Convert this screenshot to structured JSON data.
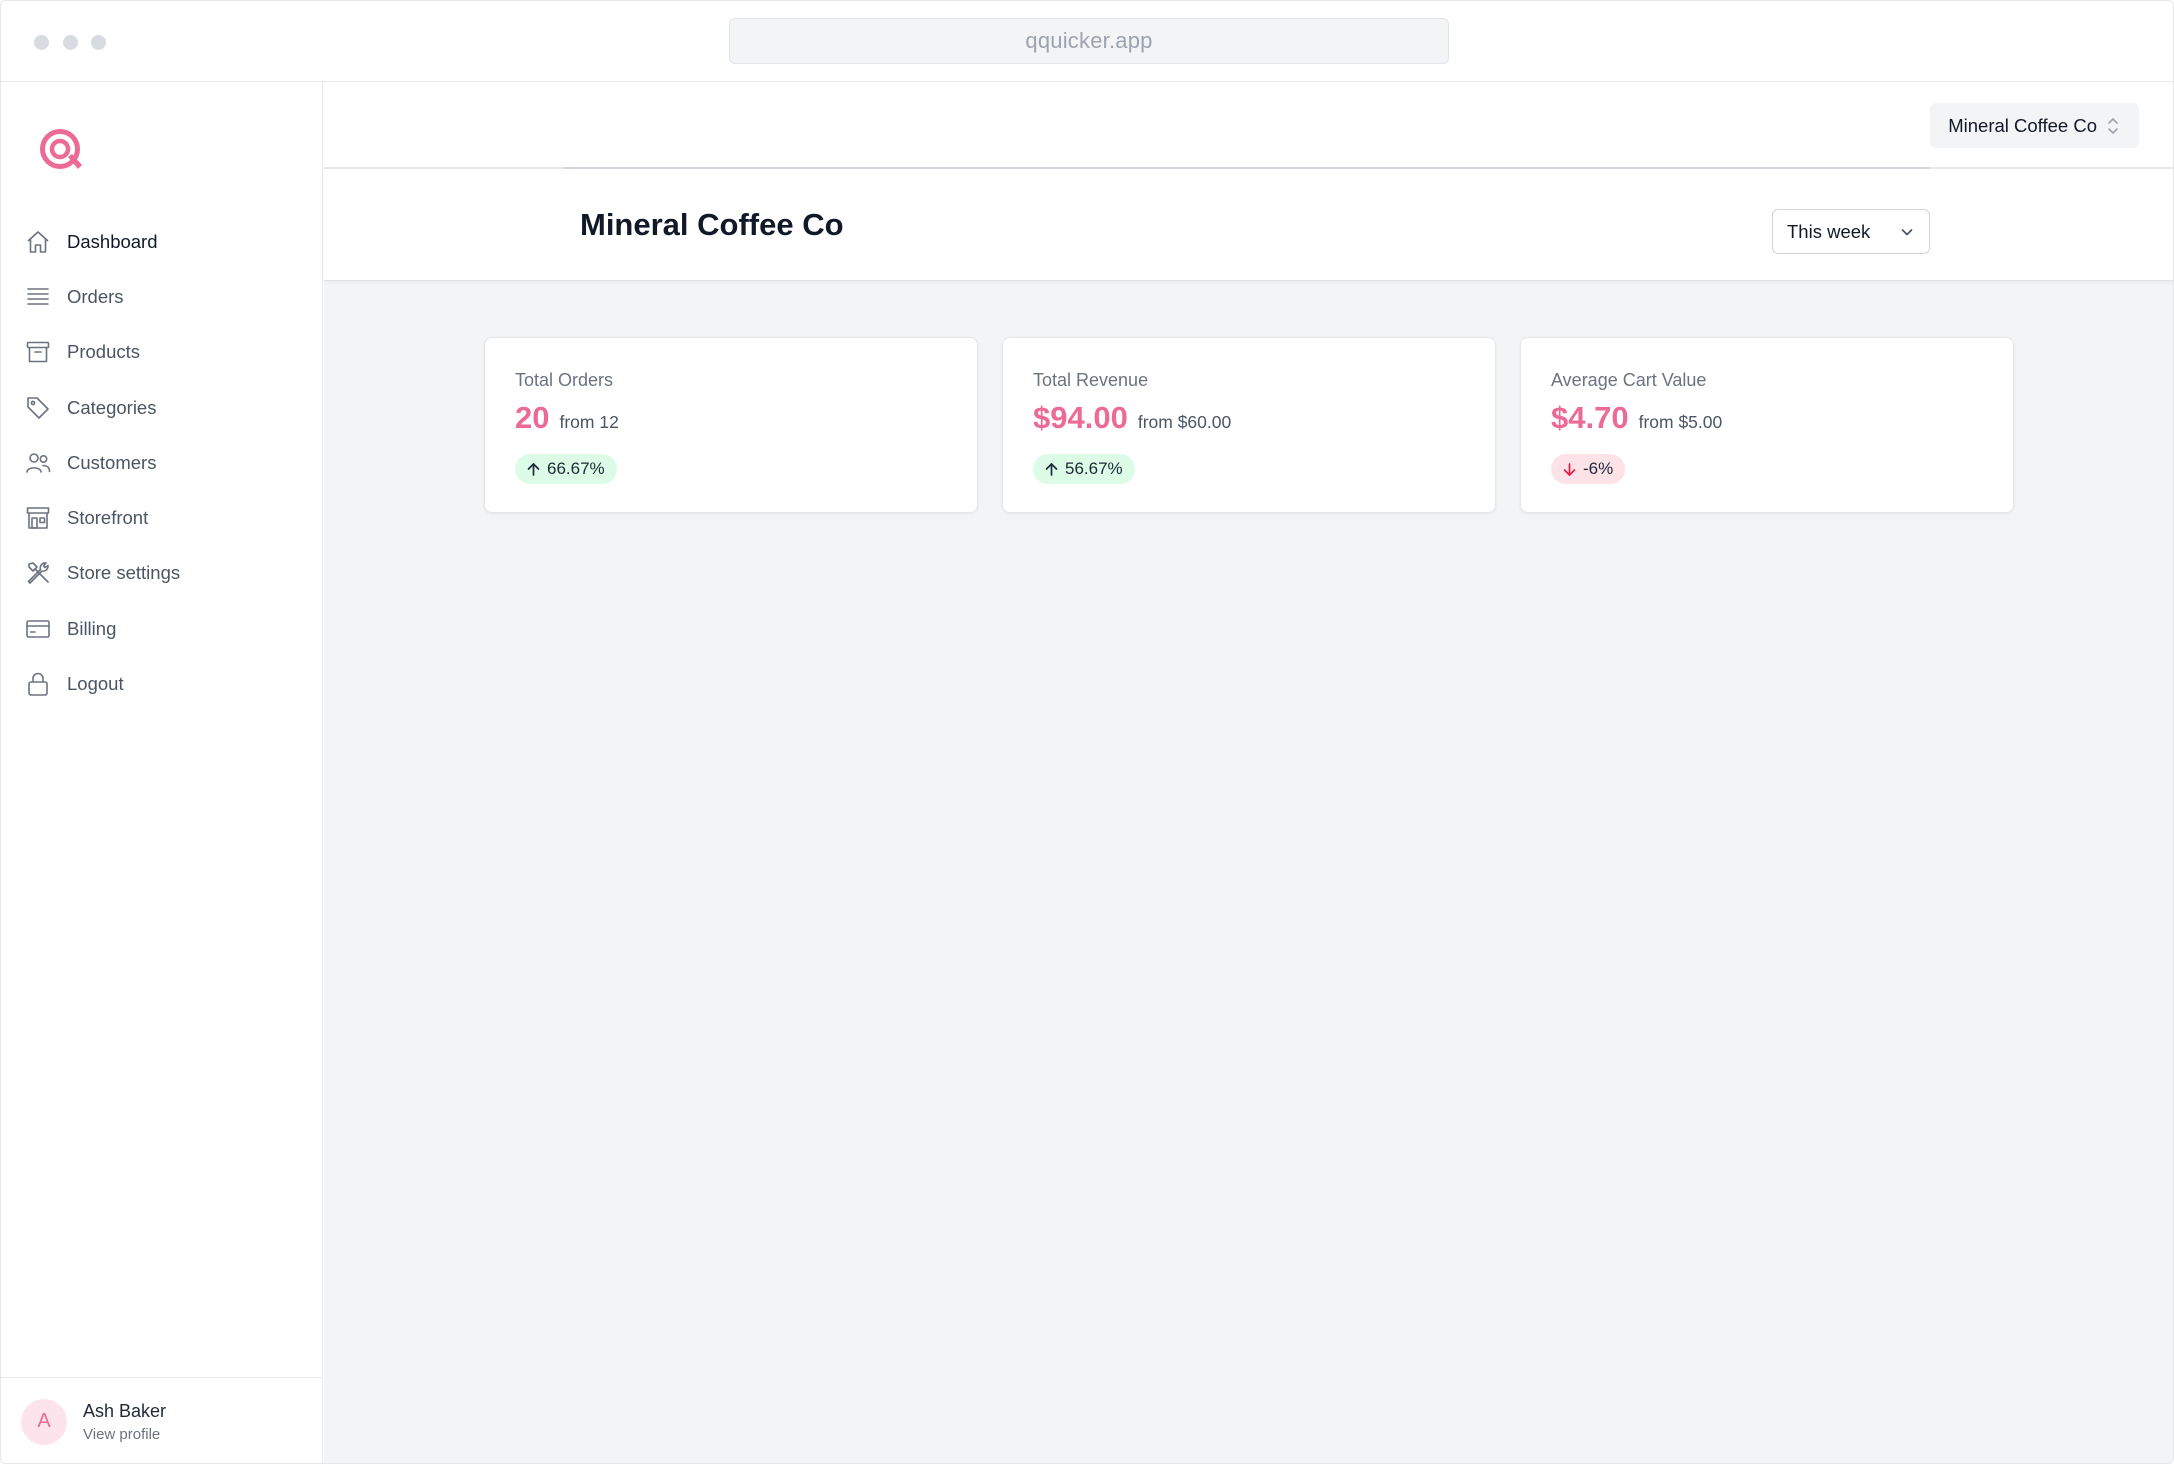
{
  "browser": {
    "url": "qquicker.app"
  },
  "sidebar": {
    "items": [
      {
        "label": "Dashboard",
        "icon": "home-icon",
        "active": true
      },
      {
        "label": "Orders",
        "icon": "list-icon"
      },
      {
        "label": "Products",
        "icon": "archive-box-icon"
      },
      {
        "label": "Categories",
        "icon": "tag-icon"
      },
      {
        "label": "Customers",
        "icon": "users-icon"
      },
      {
        "label": "Storefront",
        "icon": "storefront-icon"
      },
      {
        "label": "Store settings",
        "icon": "wrench-screwdriver-icon"
      },
      {
        "label": "Billing",
        "icon": "credit-card-icon"
      },
      {
        "label": "Logout",
        "icon": "lock-icon"
      }
    ],
    "profile": {
      "initial": "A",
      "name": "Ash Baker",
      "link": "View profile"
    }
  },
  "topbar": {
    "store_switcher": "Mineral Coffee Co"
  },
  "header": {
    "title": "Mineral Coffee Co",
    "range": "This week"
  },
  "stats": [
    {
      "label": "Total Orders",
      "value": "20",
      "from": "from 12",
      "change": "66.67%",
      "trend": "up"
    },
    {
      "label": "Total Revenue",
      "value": "$94.00",
      "from": "from $60.00",
      "change": "56.67%",
      "trend": "up"
    },
    {
      "label": "Average Cart Value",
      "value": "$4.70",
      "from": "from $5.00",
      "change": "-6%",
      "trend": "down"
    }
  ],
  "colors": {
    "accent": "#ec6a94",
    "positive_bg": "#dcfce7",
    "negative_bg": "#fde2e8",
    "background": "#f3f4f6"
  }
}
